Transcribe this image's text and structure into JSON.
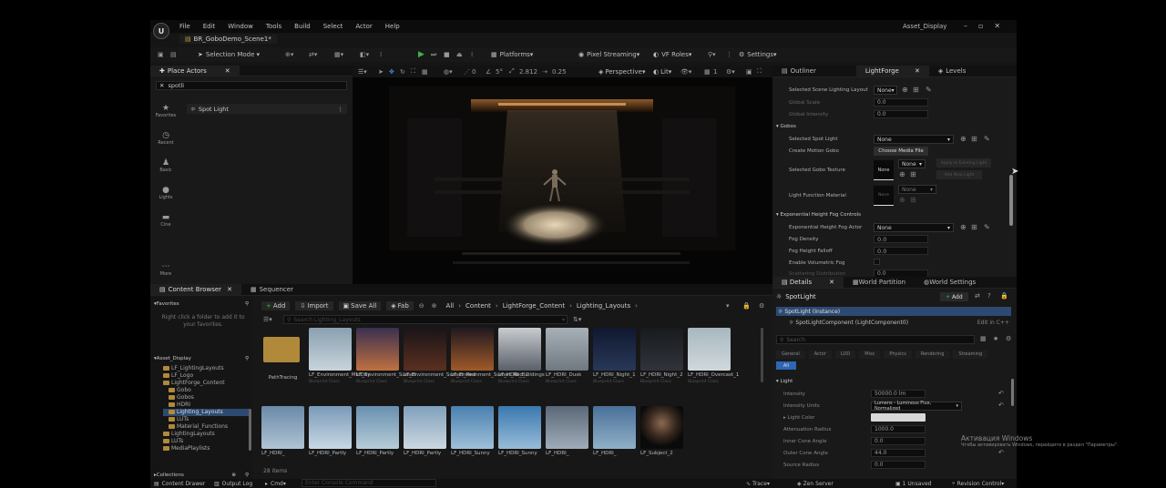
{
  "window": {
    "project_title": "Asset_Display",
    "level_tab": "BR_GoboDemo_Scene1*"
  },
  "menu": [
    "File",
    "Edit",
    "Window",
    "Tools",
    "Build",
    "Select",
    "Actor",
    "Help"
  ],
  "toolbar": {
    "selection_mode": "Selection Mode",
    "platforms": "Platforms",
    "pixel_streaming": "Pixel Streaming",
    "vf_roles": "VF Roles",
    "settings": "Settings"
  },
  "place_actors": {
    "tab": "Place Actors",
    "search_value": "spotli",
    "categories": [
      "Favorites",
      "Recent",
      "Basic",
      "Lights",
      "Cine",
      "More"
    ],
    "result": "Spot Light"
  },
  "viewport": {
    "perspective": "Perspective",
    "lit": "Lit",
    "snap_rot": "5°",
    "scale": "2.812",
    "speed": "0.25",
    "count": "0",
    "grid": "1"
  },
  "outliner_tabs": [
    "Outliner",
    "LightForge",
    "Levels"
  ],
  "lightforge": {
    "selected_layout_label": "Selected Scene Lighting Layout",
    "selected_layout_value": "None",
    "global_scale_label": "Global Scale",
    "global_scale_value": "0.0",
    "global_intensity_label": "Global Intensity",
    "global_intensity_value": "0.0",
    "gobos_section": "Gobos",
    "selected_spot_label": "Selected Spot Light",
    "selected_spot_value": "None",
    "motion_gobo_label": "Create Motion Gobo",
    "choose_media": "Choose Media File",
    "gobo_texture_label": "Selected Gobo Texture",
    "gobo_texture_thumb": "None",
    "gobo_texture_value": "None",
    "apply_existing": "Apply to Existing Light",
    "add_new_light": "Add New Light",
    "light_fn_label": "Light Function Material",
    "light_fn_thumb": "None",
    "light_fn_value": "None",
    "fog_section": "Exponential Height Fog Controls",
    "fog_actor_label": "Exponential Height Fog Actor",
    "fog_actor_value": "None",
    "fog_density_label": "Fog Density",
    "fog_density_value": "0.0",
    "fog_falloff_label": "Fog Height Falloff",
    "fog_falloff_value": "0.0",
    "vol_fog_label": "Enable Volumetric Fog",
    "cut_label": "Scattering Distribution",
    "cut_value": "0.0"
  },
  "details": {
    "tabs": [
      "Details",
      "World Partition",
      "World Settings"
    ],
    "actor": "SpotLight",
    "add": "Add",
    "instance": "SpotLight (Instance)",
    "component": "SpotLightComponent (LightComponent0)",
    "edit_cpp": "Edit in C++",
    "search_placeholder": "Search",
    "filters": [
      "General",
      "Actor",
      "LOD",
      "Misc",
      "Physics",
      "Rendering",
      "Streaming"
    ],
    "filter_all": "All",
    "light_section": "Light",
    "props": [
      {
        "label": "Intensity",
        "value": "50000.0 lm"
      },
      {
        "label": "Intensity Units",
        "value": "Lumens - Luminous Flux, Normalized"
      },
      {
        "label": "Light Color",
        "value": ""
      },
      {
        "label": "Attenuation Radius",
        "value": "1000.0"
      },
      {
        "label": "Inner Cone Angle",
        "value": "0.0"
      },
      {
        "label": "Outer Cone Angle",
        "value": "44.0"
      },
      {
        "label": "Source Radius",
        "value": "0.0"
      }
    ]
  },
  "content_browser": {
    "tabs": [
      "Content Browser",
      "Sequencer"
    ],
    "add": "Add",
    "import": "Import",
    "save_all": "Save All",
    "fab": "Fab",
    "breadcrumb": [
      "All",
      "Content",
      "LightForge_Content",
      "Lighting_Layouts"
    ],
    "search_placeholder": "Search Lighting_Layouts",
    "favorites": "Favorites",
    "favorites_hint": "Right click a folder to add it to your favorites.",
    "root": "Asset_Display",
    "tree": [
      "LF_LightingLayouts",
      "LF_Logo",
      "LightForge_Content",
      "Gobo",
      "Gobos",
      "HDRI",
      "Lighting_Layouts",
      "LUTs",
      "Material_Functions",
      "LightingLayouts",
      "LUTs",
      "MediaPlaylists"
    ],
    "collections": "Collections",
    "item_count": "28 items",
    "asset_sub": "Blueprint Class",
    "assets_row1": [
      "PathTracing",
      "LF_Environment_MidDay",
      "LF_Environment_Sunset",
      "LF_Environment_Sunset_Red",
      "LF_Environment_Sunset_Red_2",
      "LF_HDRI_Buildings",
      "LF_HDRI_Dusk",
      "LF_HDRI_Night_1",
      "LF_HDRI_Night_2",
      "LF_HDRI_Overcast_1"
    ],
    "assets_row2": [
      "LF_HDRI_",
      "LF_HDRI_Partly",
      "LF_HDRI_Partly",
      "LF_HDRI_Partly",
      "LF_HDRI_Sunny",
      "LF_HDRI_Sunny",
      "LF_HDRI_",
      "LF_HDRI_",
      "LF_Subject_2"
    ]
  },
  "status": {
    "content_drawer": "Content Drawer",
    "output_log": "Output Log",
    "cmd": "Cmd",
    "console_placeholder": "Enter Console Command",
    "trace": "Trace",
    "derived": "Zen Server",
    "unsaved": "1 Unsaved",
    "revision": "Revision Control"
  },
  "watermark": {
    "line1": "Активация Windows",
    "line2": "Чтобы активировать Windows, перейдите в раздел \"Параметры\"."
  }
}
